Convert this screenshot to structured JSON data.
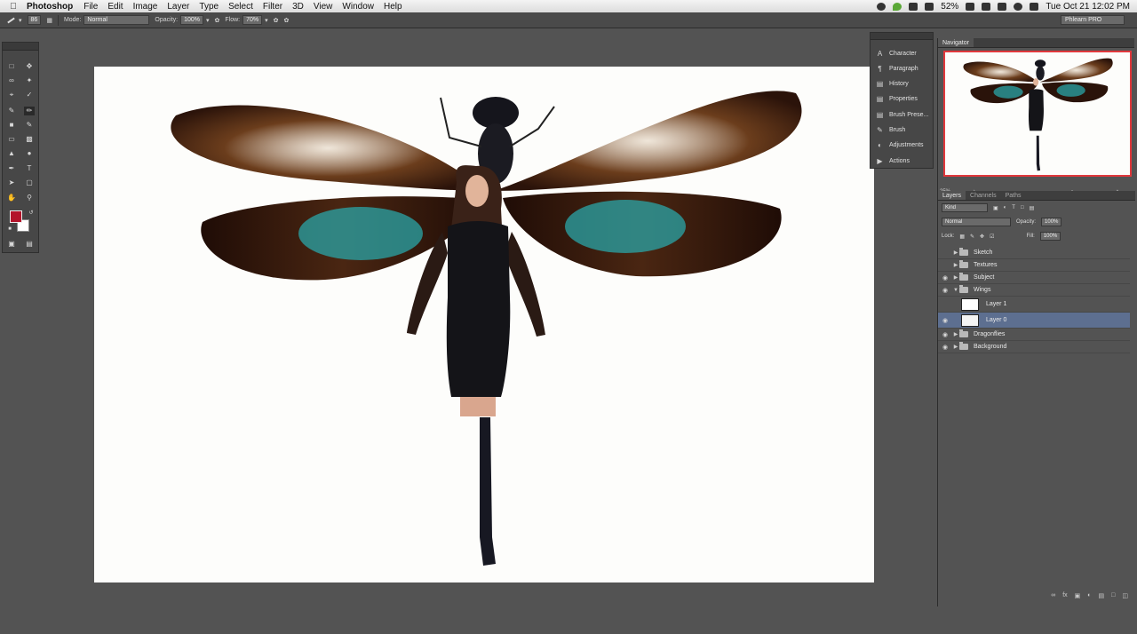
{
  "menubar": {
    "app_name": "Photoshop",
    "menus": [
      "File",
      "Edit",
      "Image",
      "Layer",
      "Type",
      "Select",
      "Filter",
      "3D",
      "View",
      "Window",
      "Help"
    ],
    "battery": "52%",
    "clock": "Tue Oct 21  12:02 PM"
  },
  "options": {
    "brush_size": "86",
    "mode_label": "Mode:",
    "mode_value": "Normal",
    "opacity_label": "Opacity:",
    "opacity_value": "100%",
    "flow_label": "Flow:",
    "flow_value": "70%",
    "workspace": "Phlearn PRO"
  },
  "dock": {
    "items": [
      {
        "label": "Character",
        "icon": "character-icon"
      },
      {
        "label": "Paragraph",
        "icon": "paragraph-icon"
      },
      {
        "label": "History",
        "icon": "history-icon"
      },
      {
        "label": "Properties",
        "icon": "properties-icon"
      },
      {
        "label": "Brush Prese...",
        "icon": "brush-presets-icon"
      },
      {
        "label": "Brush",
        "icon": "brush-icon"
      },
      {
        "label": "Adjustments",
        "icon": "adjustments-icon"
      },
      {
        "label": "Actions",
        "icon": "actions-icon"
      }
    ]
  },
  "navigator": {
    "tab": "Navigator",
    "zoom": "25%"
  },
  "layers_panel": {
    "tabs": [
      "Layers",
      "Channels",
      "Paths"
    ],
    "filter_kind": "Kind",
    "blend_mode": "Normal",
    "opacity_label": "Opacity:",
    "opacity_value": "100%",
    "lock_label": "Lock:",
    "fill_label": "Fill:",
    "fill_value": "100%",
    "layers": [
      {
        "name": "Sketch",
        "type": "group",
        "visible": false,
        "expanded": false
      },
      {
        "name": "Textures",
        "type": "group",
        "visible": false,
        "expanded": false
      },
      {
        "name": "Subject",
        "type": "group",
        "visible": true,
        "expanded": false
      },
      {
        "name": "Wings",
        "type": "group",
        "visible": true,
        "expanded": true
      },
      {
        "name": "Layer 1",
        "type": "layer",
        "visible": false
      },
      {
        "name": "Layer 0",
        "type": "layer",
        "visible": true,
        "selected": true
      },
      {
        "name": "Dragonflies",
        "type": "group",
        "visible": true,
        "expanded": false
      },
      {
        "name": "Background",
        "type": "group",
        "visible": true,
        "expanded": false
      }
    ]
  },
  "colors": {
    "foreground": "#b3142a",
    "background": "#ffffff",
    "selection": "#5d6f90",
    "navigator_frame": "#e0383c"
  }
}
